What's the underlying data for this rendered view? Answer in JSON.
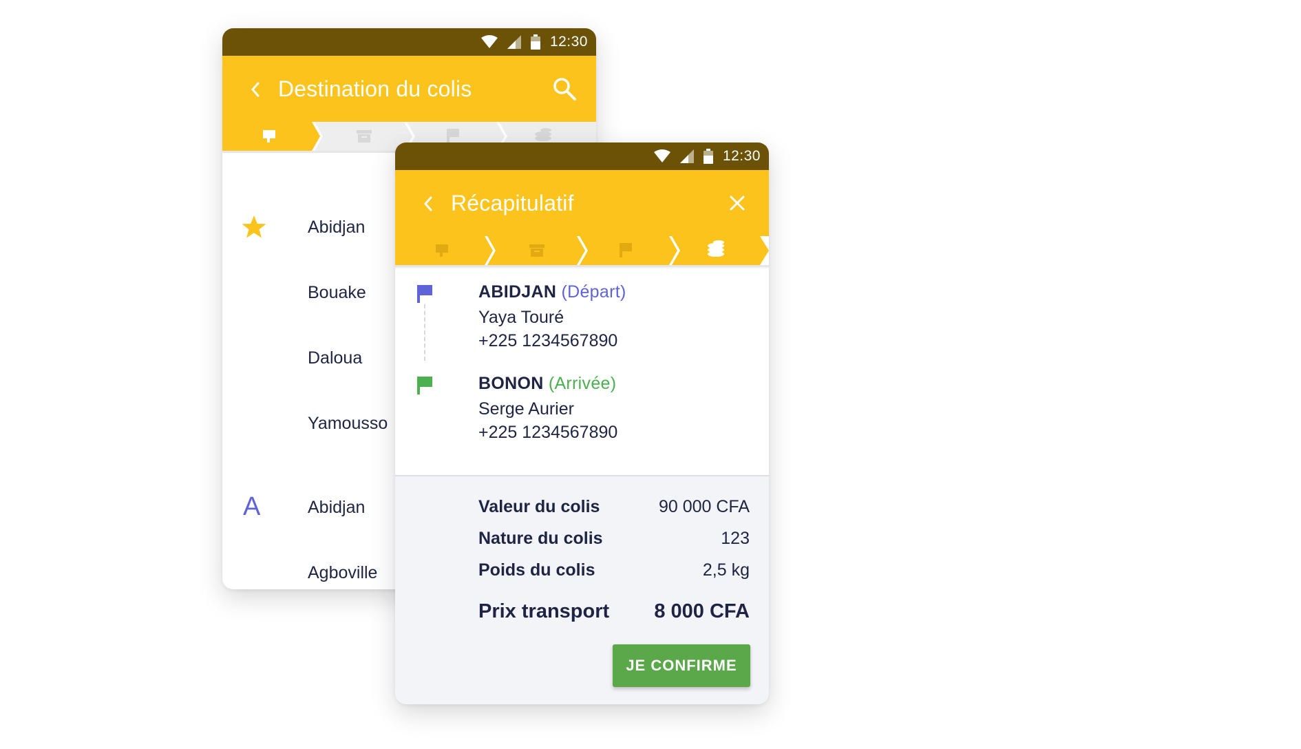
{
  "status_bar": {
    "time": "12:30"
  },
  "back_screen": {
    "title": "Destination du colis",
    "favorites_icon": "star-icon",
    "favorites": [
      "Abidjan",
      "Bouake",
      "Daloua",
      "Yamousso"
    ],
    "section_letter": "A",
    "section_items": [
      "Abidjan",
      "Agboville"
    ]
  },
  "front_screen": {
    "title": "Récapitulatif",
    "departure": {
      "city": "ABIDJAN",
      "tag": "(Départ)",
      "name": "Yaya Touré",
      "phone": "+225 1234567890",
      "color": "#5f63d8"
    },
    "arrival": {
      "city": "BONON",
      "tag": "(Arrivée)",
      "name": "Serge Aurier",
      "phone": "+225 1234567890",
      "color": "#4caf50"
    },
    "summary": [
      {
        "label": "Valeur du colis",
        "value": "90 000 CFA"
      },
      {
        "label": "Nature du colis",
        "value": "123"
      },
      {
        "label": "Poids du colis",
        "value": "2,5 kg"
      }
    ],
    "total": {
      "label": "Prix transport",
      "value": "8 000 CFA"
    },
    "confirm_label": "JE CONFIRME"
  },
  "colors": {
    "status_bar": "#6b5207",
    "app_bar": "#fbc31b",
    "step_inactive": "#eeeeee",
    "confirm": "#5aa849"
  }
}
